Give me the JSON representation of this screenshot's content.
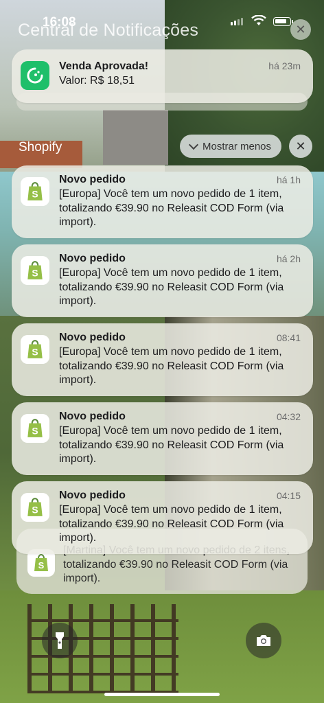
{
  "status_bar": {
    "time": "16:08",
    "battery_level": 0.8
  },
  "header": {
    "title": "Central de Notificações"
  },
  "pinned_notification": {
    "app_icon": "sales-app-icon",
    "title": "Venda Aprovada!",
    "time": "há 23m",
    "body": "Valor: R$ 18,51"
  },
  "group": {
    "app_name": "Shopify",
    "show_less_label": "Mostrar menos",
    "close_icon": "close-icon",
    "notifications": [
      {
        "title": "Novo pedido",
        "time": "há 1h",
        "body": "[Europa] Você tem um novo pedido de 1 item, totalizando €39.90 no Releasit COD Form (via import)."
      },
      {
        "title": "Novo pedido",
        "time": "há 2h",
        "body": "[Europa] Você tem um novo pedido de 1 item, totalizando €39.90 no Releasit COD Form (via import)."
      },
      {
        "title": "Novo pedido",
        "time": "08:41",
        "body": "[Europa] Você tem um novo pedido de 1 item, totalizando €39.90 no Releasit COD Form (via import)."
      },
      {
        "title": "Novo pedido",
        "time": "04:32",
        "body": "[Europa] Você tem um novo pedido de 1 item, totalizando €39.90 no Releasit COD Form (via import)."
      },
      {
        "title": "Novo pedido",
        "time": "04:15",
        "body": "[Europa] Você tem um novo pedido de 1 item, totalizando €39.90 no Releasit COD Form (via import)."
      }
    ],
    "partially_hidden": {
      "body_partial": "[Martina] Você tem um novo pedido de 2 itens, totalizando €39.90 no Releasit COD Form (via import)."
    }
  },
  "lock_controls": {
    "left": "flashlight-icon",
    "right": "camera-icon"
  }
}
